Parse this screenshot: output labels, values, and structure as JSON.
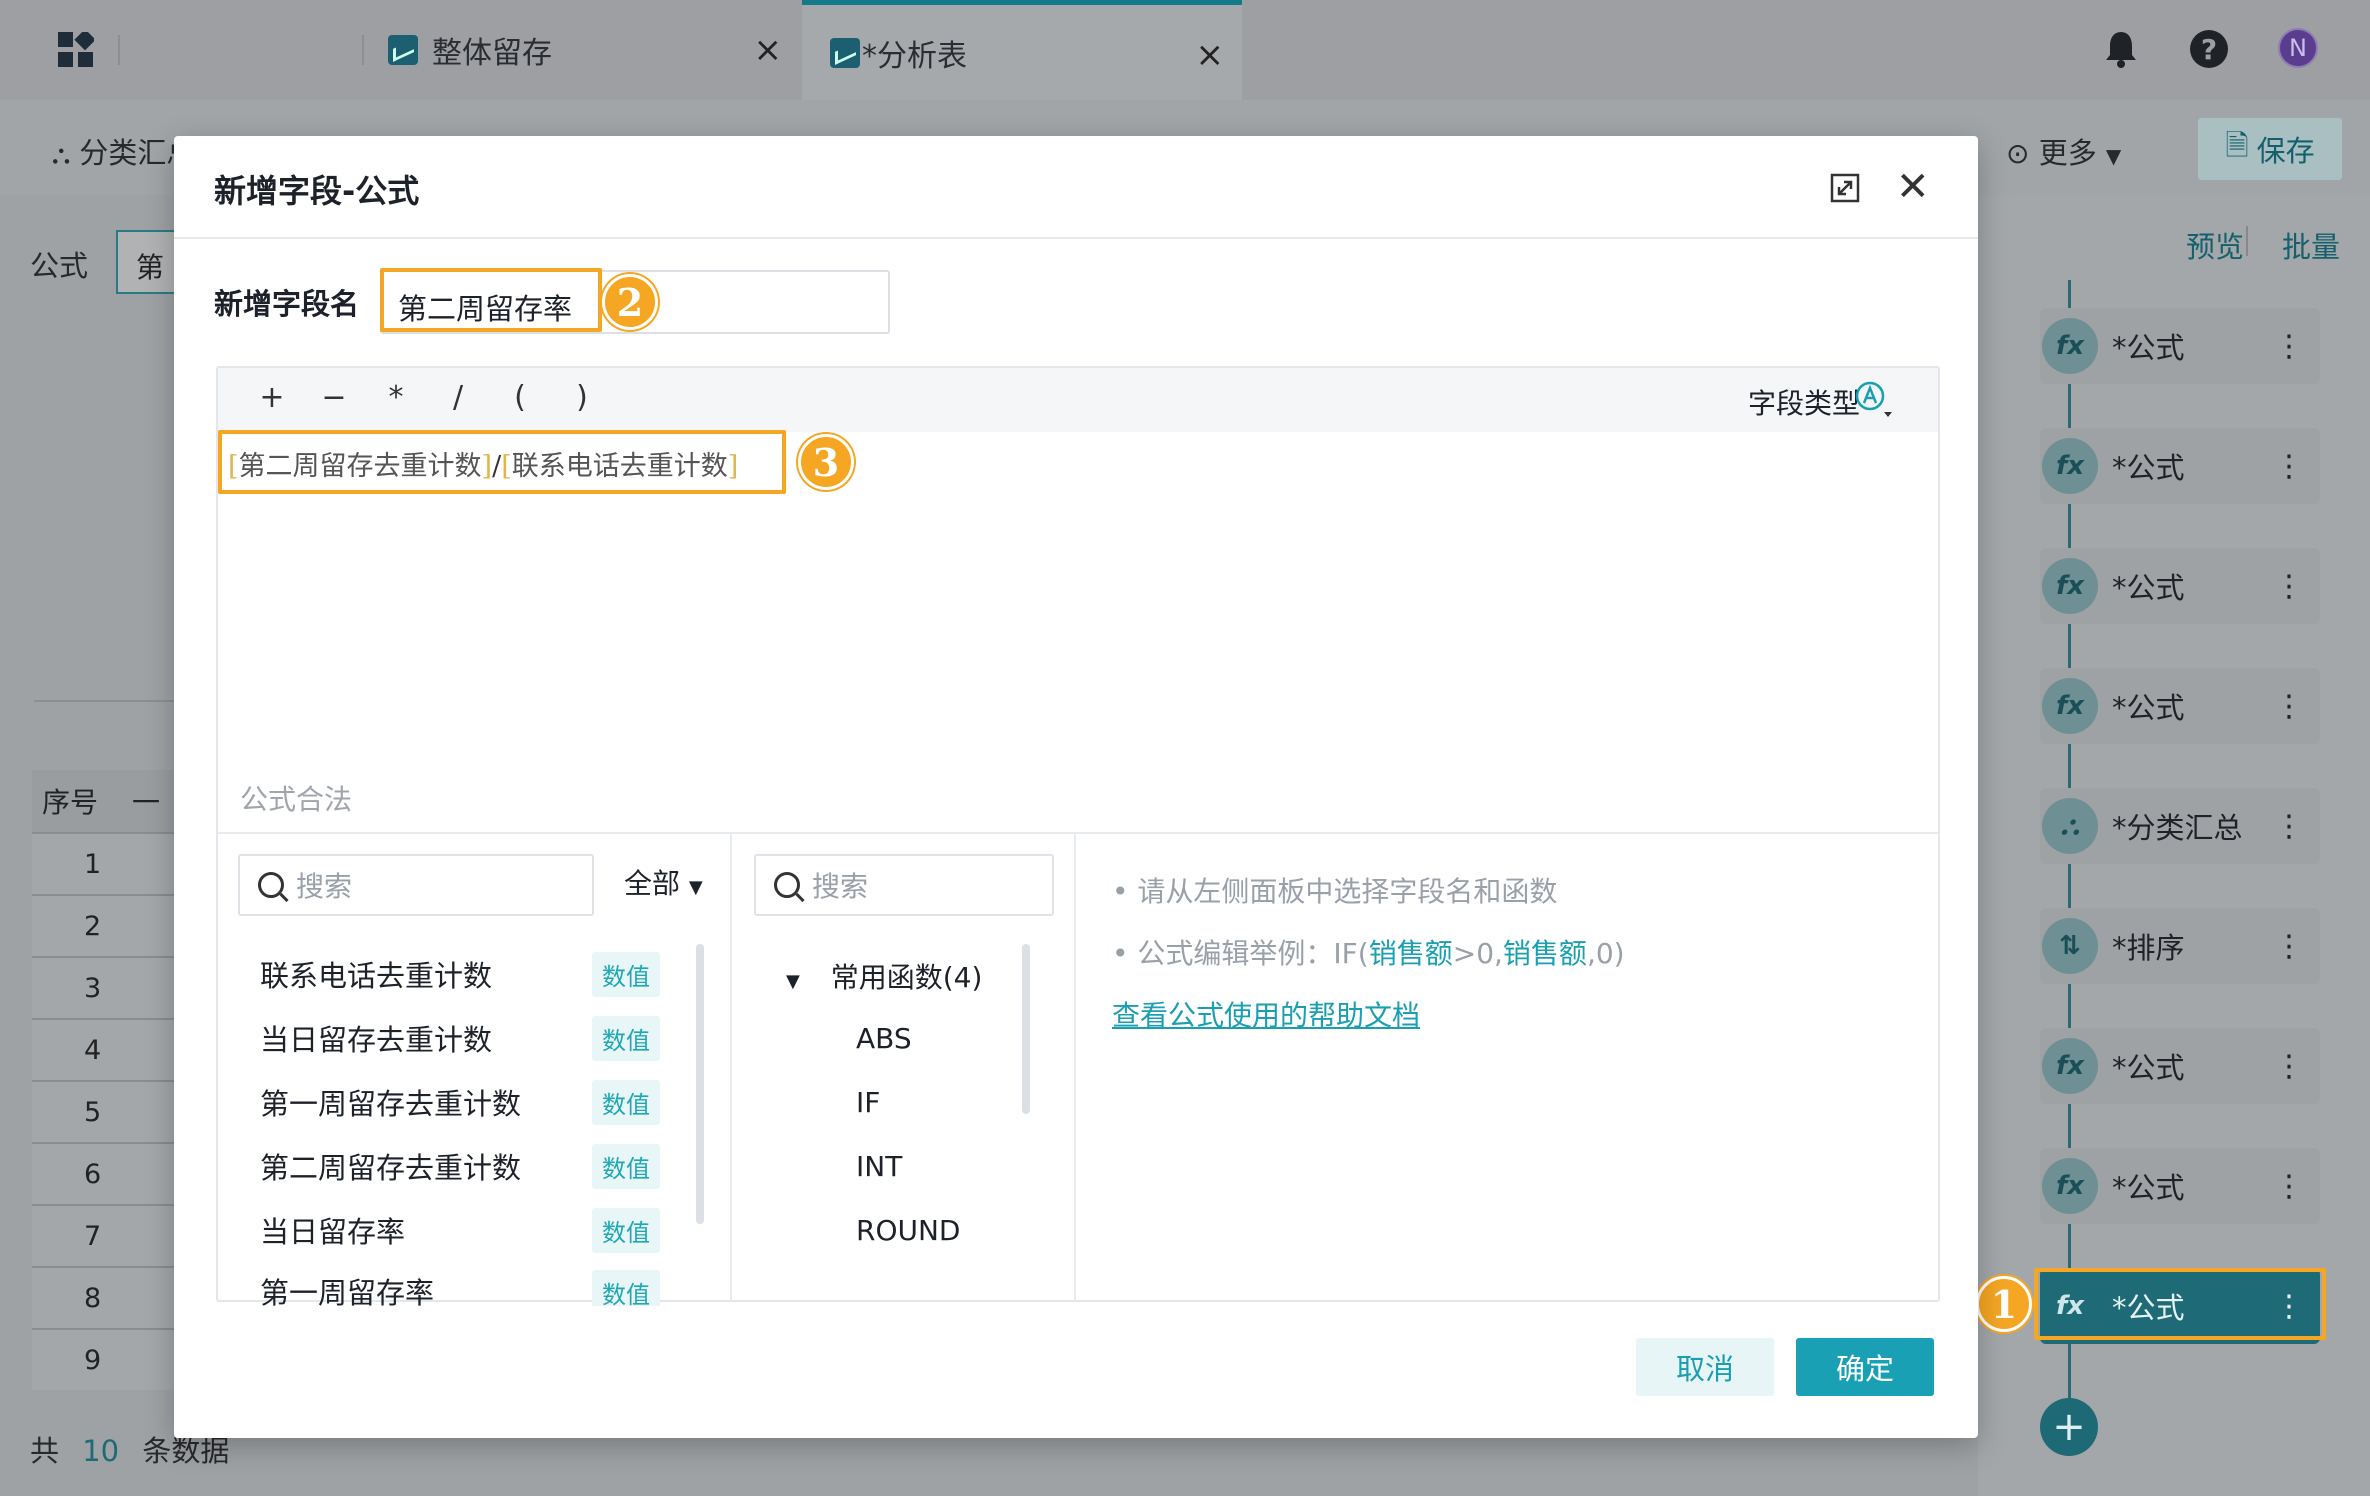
{
  "tabs": [
    {
      "label": "整体留存"
    },
    {
      "label": "*分析表"
    }
  ],
  "header": {
    "user_initial": "N"
  },
  "toolbar": {
    "classify_label": "分类汇总",
    "more_label": "更多",
    "save_label": "保存"
  },
  "left": {
    "formula_label": "公式",
    "formula_value": "第",
    "table_header": [
      "序号",
      "一"
    ],
    "row_numbers": [
      "1",
      "2",
      "3",
      "4",
      "5",
      "6",
      "7",
      "8",
      "9"
    ],
    "footer": {
      "prefix": "共",
      "count": "10",
      "suffix": "条数据"
    }
  },
  "right": {
    "preview_label": "预览",
    "batch_label": "批量",
    "steps": [
      {
        "icon": "fx",
        "label": "*公式"
      },
      {
        "icon": "fx",
        "label": "*公式"
      },
      {
        "icon": "fx",
        "label": "*公式"
      },
      {
        "icon": "fx",
        "label": "*公式"
      },
      {
        "icon": "group",
        "label": "*分类汇总"
      },
      {
        "icon": "sort",
        "label": "*排序"
      },
      {
        "icon": "fx",
        "label": "*公式"
      },
      {
        "icon": "fx",
        "label": "*公式"
      },
      {
        "icon": "fx",
        "label": "*公式"
      }
    ]
  },
  "modal": {
    "title": "新增字段-公式",
    "field_name_label": "新增字段名",
    "field_name_value": "第二周留存率",
    "operators": [
      "+",
      "−",
      "*",
      "/",
      "(",
      ")"
    ],
    "field_type_label": "字段类型",
    "formula": {
      "field1": "第二周留存去重计数",
      "op": "/",
      "field2": "联系电话去重计数"
    },
    "validity": "公式合法",
    "field_search_placeholder": "搜索",
    "field_filter": "全部",
    "fields": [
      {
        "name": "联系电话去重计数",
        "type": "数值"
      },
      {
        "name": "当日留存去重计数",
        "type": "数值"
      },
      {
        "name": "第一周留存去重计数",
        "type": "数值"
      },
      {
        "name": "第二周留存去重计数",
        "type": "数值"
      },
      {
        "name": "当日留存率",
        "type": "数值"
      },
      {
        "name": "第一周留存率",
        "type": "数值"
      }
    ],
    "func_search_placeholder": "搜索",
    "func_group": "常用函数(4)",
    "functions": [
      "ABS",
      "IF",
      "INT",
      "ROUND"
    ],
    "hints": {
      "line1": "请从左侧面板中选择字段名和函数",
      "line2_prefix": "公式编辑举例：IF(",
      "line2_field": "销售额",
      "line2_mid": ">0,",
      "line2_field2": "销售额",
      "line2_suffix": ",0)",
      "help_link": "查看公式使用的帮助文档"
    },
    "cancel_label": "取消",
    "ok_label": "确定"
  },
  "annotations": {
    "badge1": "1",
    "badge2": "2",
    "badge3": "3"
  },
  "colors": {
    "accent": "#1a9fb2",
    "highlight": "#f5a623"
  }
}
